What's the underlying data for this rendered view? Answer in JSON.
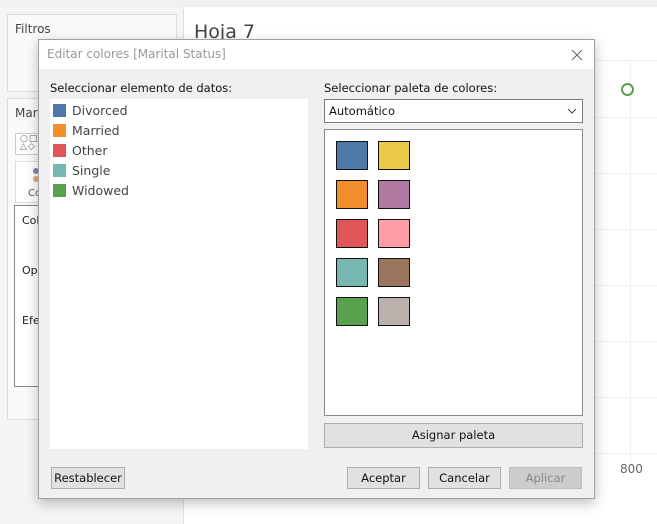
{
  "workbook": {
    "filters_title": "Filtros",
    "marks_title": "Marc",
    "marks_type_icon": "shapes-icon",
    "color_button_label": "Co",
    "color_popup_items": [
      "Colo",
      "Opa",
      "Efe"
    ],
    "sheet_title": "Hoja 7",
    "axis_tick": "800"
  },
  "dialog": {
    "title": "Editar colores [Marital Status]",
    "close_icon": "close-icon",
    "data_label": "Seleccionar elemento de datos:",
    "data_items": [
      {
        "label": "Divorced",
        "color": "#4e79a7"
      },
      {
        "label": "Married",
        "color": "#f28e2b"
      },
      {
        "label": "Other",
        "color": "#e15759"
      },
      {
        "label": "Single",
        "color": "#76b7b2"
      },
      {
        "label": "Widowed",
        "color": "#59a14f"
      }
    ],
    "palette_label": "Seleccionar paleta de colores:",
    "palette_value": "Automático",
    "palette_colors": [
      [
        "#4e79a7",
        "#edc948"
      ],
      [
        "#f28e2b",
        "#b07aa1"
      ],
      [
        "#e15759",
        "#ff9da7"
      ],
      [
        "#76b7b2",
        "#9c755f"
      ],
      [
        "#59a14f",
        "#bab0ac"
      ]
    ],
    "assign_palette": "Asignar paleta",
    "reset": "Restablecer",
    "accept": "Aceptar",
    "cancel": "Cancelar",
    "apply": "Aplicar"
  }
}
